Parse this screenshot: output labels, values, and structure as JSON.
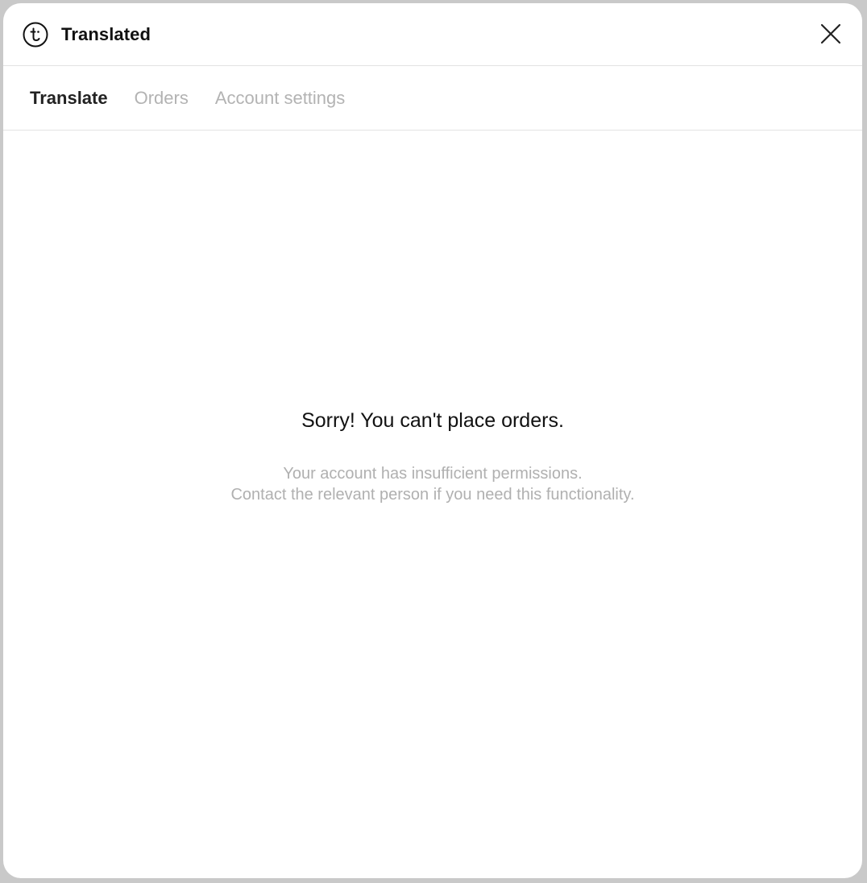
{
  "app": {
    "title": "Translated",
    "logo_icon": "translated-logo-icon",
    "close_icon": "close-icon"
  },
  "tabs": [
    {
      "label": "Translate",
      "active": true
    },
    {
      "label": "Orders",
      "active": false
    },
    {
      "label": "Account settings",
      "active": false
    }
  ],
  "message": {
    "title": "Sorry! You can't place orders.",
    "line1": "Your account has insufficient permissions.",
    "line2": "Contact the relevant person if you need this functionality."
  },
  "colors": {
    "active_tab": "#222222",
    "inactive_tab": "#b3b3b3",
    "muted_text": "#b0b0b0",
    "divider": "#e2e2e2"
  }
}
